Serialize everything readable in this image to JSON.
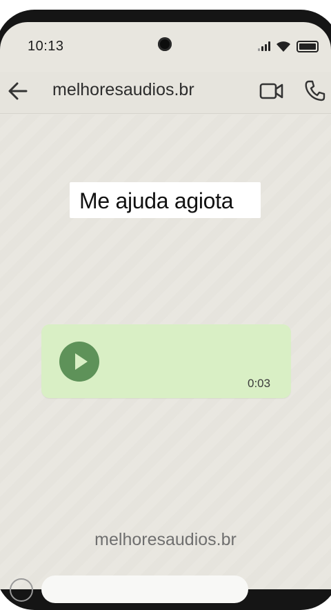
{
  "status_bar": {
    "time": "10:13"
  },
  "header": {
    "contact_name": "melhoresaudios.br"
  },
  "messages": [
    {
      "type": "text",
      "text": "Me ajuda agiota"
    },
    {
      "type": "voice",
      "duration": "0:03"
    }
  ],
  "watermark": "melhoresaudios.br",
  "colors": {
    "voice_bubble": "#d9efc5",
    "play_button": "#5e9259",
    "wallpaper": "#e9e7e0"
  },
  "icons": {
    "back": "arrow-left-icon",
    "video": "video-camera-icon",
    "call": "phone-icon",
    "play": "play-icon"
  }
}
